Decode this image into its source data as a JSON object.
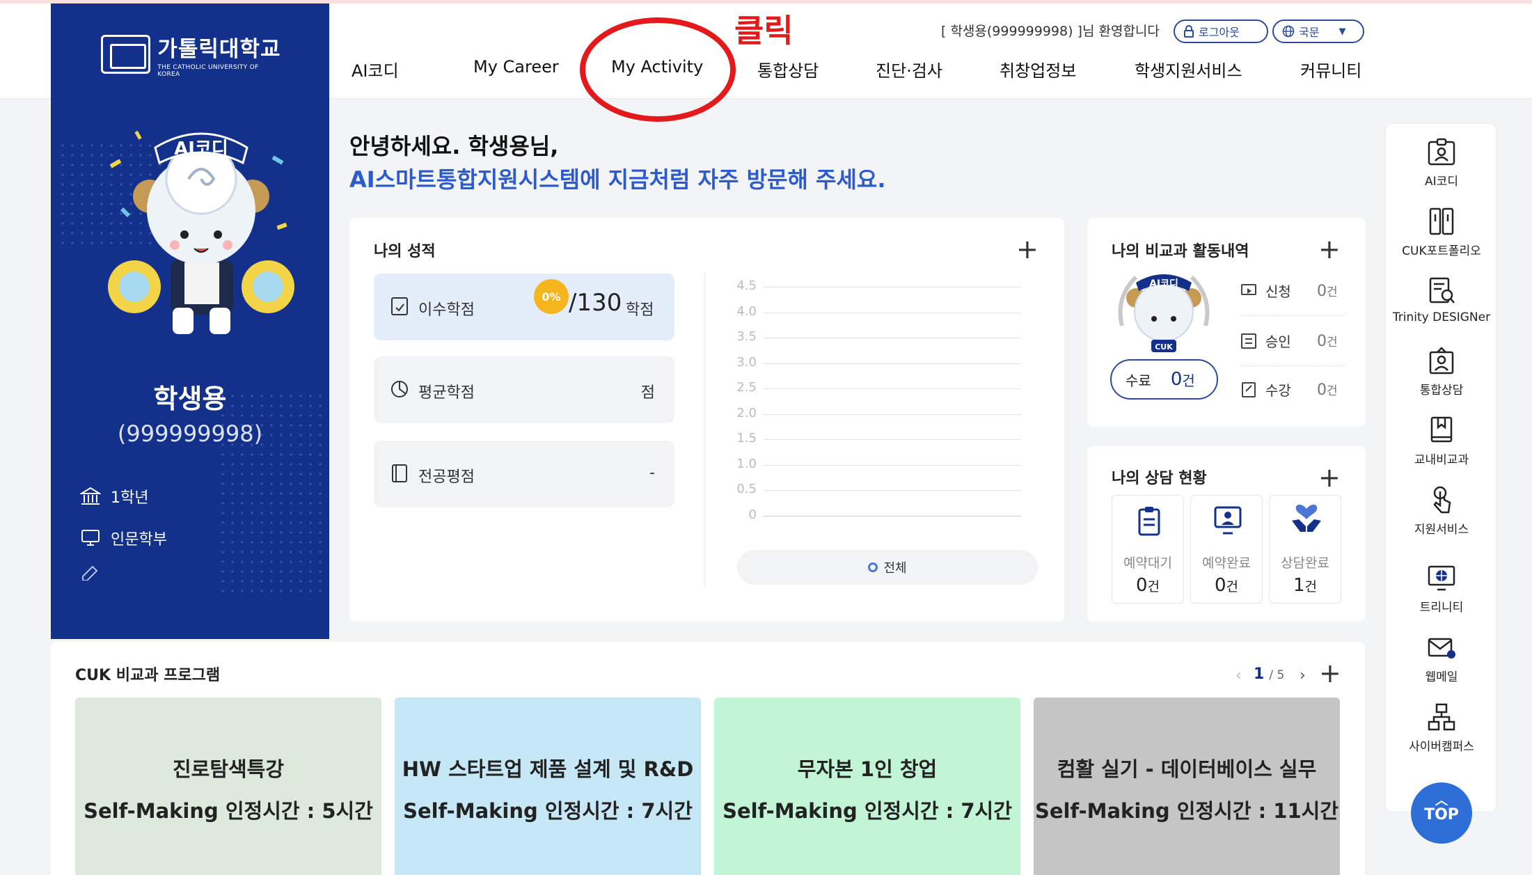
{
  "header": {
    "logo_kr": "가톨릭대학교",
    "logo_en": "THE CATHOLIC UNIVERSITY OF KOREA",
    "welcome": "[ 학생용(999999998) ]님 환영합니다",
    "logout": "로그아웃",
    "language": "국문",
    "nav": [
      "AI코디",
      "My Career",
      "My Activity",
      "통합상담",
      "진단·검사",
      "취창업정보",
      "학생지원서비스",
      "커뮤니티"
    ]
  },
  "annotation": {
    "text": "클릭"
  },
  "profile": {
    "mascot_label": "AI코디",
    "name": "학생용",
    "id": "(999999998)",
    "grade": "1학년",
    "department": "인문학부"
  },
  "greeting": {
    "line1": "안녕하세요. 학생용님,",
    "line2": "AI스마트통합지원시스템에 지금처럼 자주 방문해 주세요."
  },
  "grades": {
    "title": "나의 성적",
    "credits_label": "이수학점",
    "credits_badge": "0%",
    "credits_value": "/130",
    "credits_unit": "학점",
    "gpa_label": "평균학점",
    "gpa_value": "점",
    "major_label": "전공평점",
    "major_value": "-",
    "y_ticks": [
      "4.5",
      "4.0",
      "3.5",
      "3.0",
      "2.5",
      "2.0",
      "1.5",
      "1.0",
      "0.5",
      "0"
    ],
    "legend": "전체"
  },
  "activity": {
    "title": "나의 비교과 활동내역",
    "mascot_label": "AI코디",
    "mascot_badge": "CUK",
    "complete_label": "수료",
    "complete_count": "0",
    "complete_unit": "건",
    "rows": [
      {
        "label": "신청",
        "count": "0",
        "unit": "건"
      },
      {
        "label": "승인",
        "count": "0",
        "unit": "건"
      },
      {
        "label": "수강",
        "count": "0",
        "unit": "건"
      }
    ]
  },
  "counsel": {
    "title": "나의 상담 현황",
    "boxes": [
      {
        "label": "예약대기",
        "count": "0",
        "unit": "건"
      },
      {
        "label": "예약완료",
        "count": "0",
        "unit": "건"
      },
      {
        "label": "상담완료",
        "count": "1",
        "unit": "건"
      }
    ]
  },
  "rail": {
    "items": [
      "AI코디",
      "CUK포트폴리오",
      "Trinity DESIGNer",
      "통합상담",
      "교내비교과",
      "지원서비스",
      "트리니티",
      "웹메일",
      "사이버캠퍼스"
    ],
    "top": "TOP"
  },
  "programs": {
    "title": "CUK 비교과 프로그램",
    "page_current": "1",
    "page_total": "/ 5",
    "cards": [
      {
        "title": "진로탐색특강",
        "hours": "Self-Making 인정시간 : 5시간",
        "color": "#dce9dc"
      },
      {
        "title": "HW 스타트업 제품 설계 및 R&D",
        "hours": "Self-Making  인정시간 : 7시간",
        "color": "#c6e7f5"
      },
      {
        "title": "무자본 1인 창업",
        "hours": "Self-Making 인정시간 : 7시간",
        "color": "#c2f4d6"
      },
      {
        "title": "컴활 실기 - 데이터베이스 실무",
        "hours": "Self-Making 인정시간 : 11시간",
        "color": "#c5c5c5"
      }
    ]
  },
  "colors": {
    "brand": "#13318a",
    "accent_blue": "#2c5bd0",
    "annotation_red": "#e3191b",
    "badge_yellow": "#f5b51d"
  }
}
